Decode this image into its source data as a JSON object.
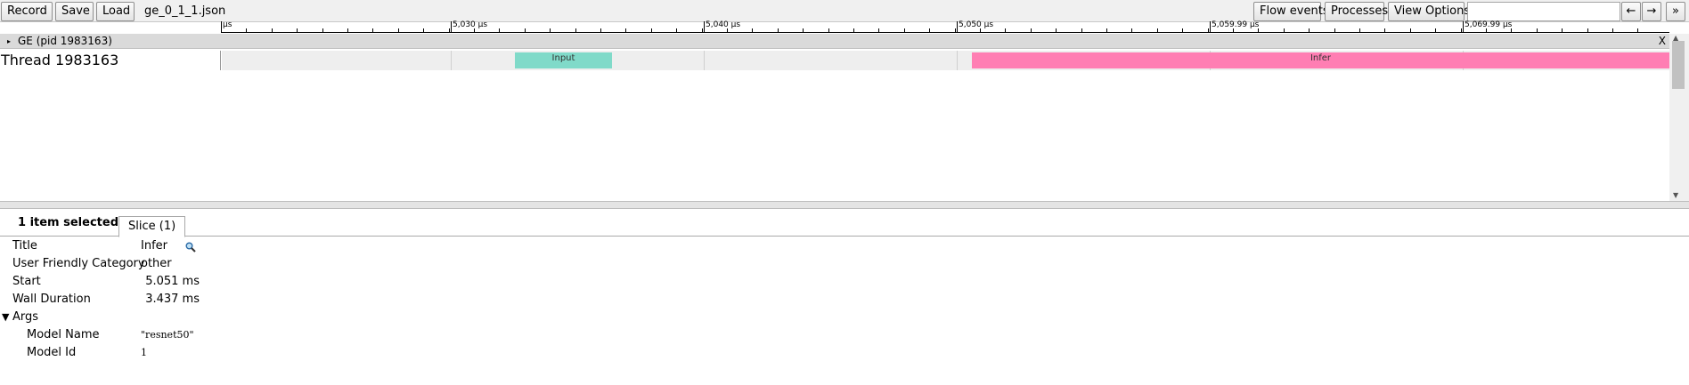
{
  "toolbar": {
    "record": "Record",
    "save": "Save",
    "load": "Load",
    "filename": "ge_0_1_1.json",
    "flow_events": "Flow events",
    "processes": "Processes",
    "view_options": "View Options",
    "search_value": "",
    "prev": "←",
    "next": "→",
    "more": "»"
  },
  "ruler": {
    "labels": [
      "μs",
      "5,030 μs",
      "5,040 μs",
      "5,050 μs",
      "5,059.99 μs",
      "5,069.99 μs"
    ]
  },
  "process": {
    "toggle": "▸",
    "title": "GE (pid 1983163)",
    "close": "X"
  },
  "thread": {
    "label": "Thread 1983163",
    "slices": [
      {
        "name": "Input",
        "color": "#80dac9"
      },
      {
        "name": "Infer",
        "color": "#ff7eb3"
      }
    ]
  },
  "panel": {
    "selected": "1 item selected.",
    "tab": "Slice (1)",
    "fields": {
      "title_k": "Title",
      "title_v": "Infer",
      "cat_k": "User Friendly Category",
      "cat_v": "other",
      "start_k": "Start",
      "start_v": "5.051 ms",
      "dur_k": "Wall Duration",
      "dur_v": "3.437 ms",
      "args_toggle": "▼",
      "args_k": "Args",
      "model_name_k": "Model Name",
      "model_name_v": "\"resnet50\"",
      "model_id_k": "Model Id",
      "model_id_v": "1"
    }
  },
  "icons": {
    "search": "search-icon"
  }
}
